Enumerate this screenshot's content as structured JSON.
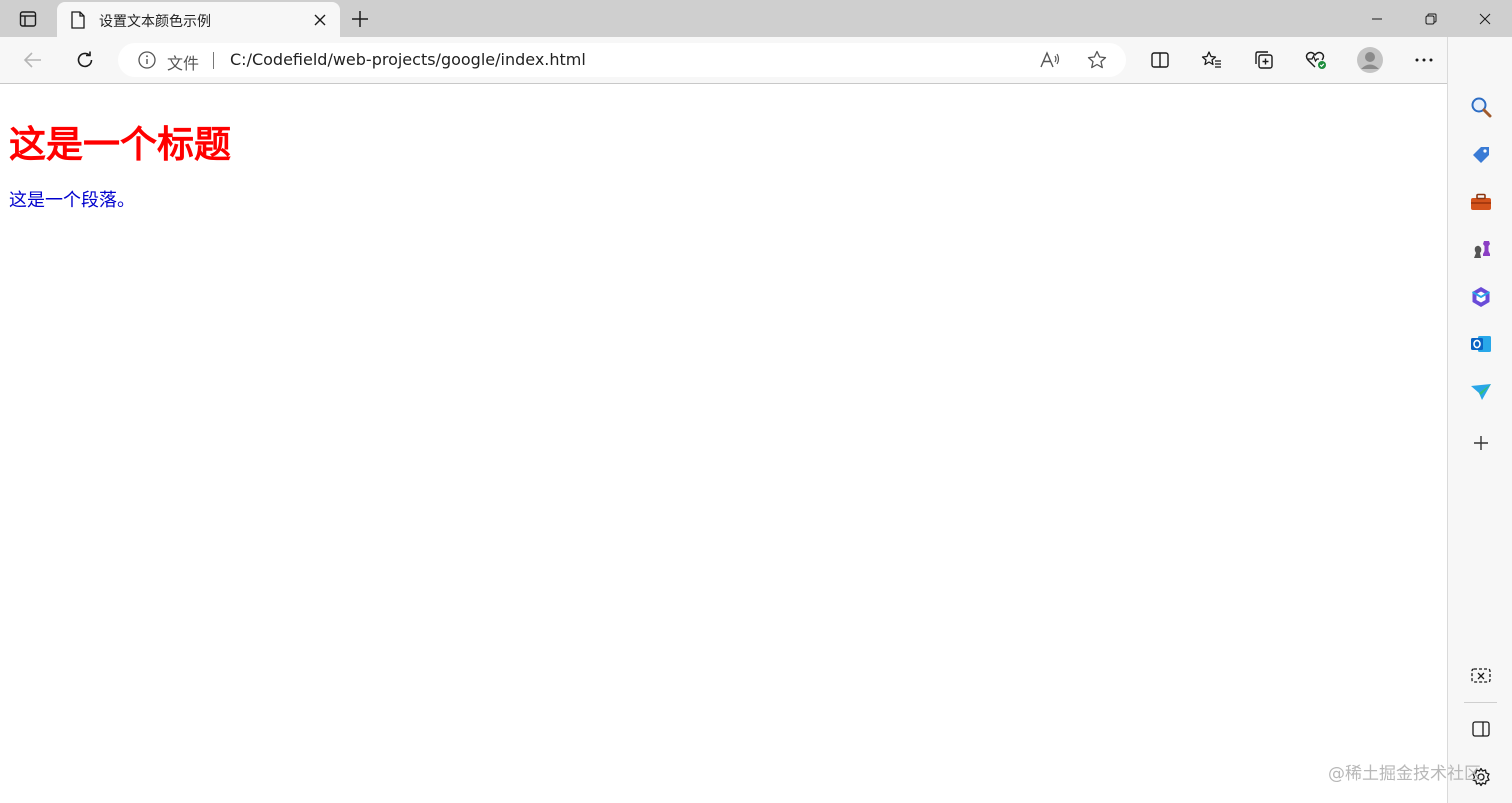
{
  "tab": {
    "title": "设置文本颜色示例"
  },
  "addressbar": {
    "scheme_label": "文件",
    "url": "C:/Codefield/web-projects/google/index.html"
  },
  "page": {
    "heading": "这是一个标题",
    "paragraph": "这是一个段落。"
  },
  "watermark": "@稀土掘金技术社区",
  "colors": {
    "heading": "#ff0000",
    "paragraph": "#0000cd",
    "tabstrip": "#cfcfcf",
    "toolbar": "#f7f7f7"
  },
  "icons": {
    "tab_actions": "tab-actions-icon",
    "back": "back-arrow-icon",
    "refresh": "refresh-icon",
    "info": "info-icon",
    "read_aloud": "read-aloud-icon",
    "favorite": "star-icon",
    "split_screen": "split-screen-icon",
    "favorites": "favorites-icon",
    "collections": "collections-icon",
    "browser_essentials": "heart-pulse-icon",
    "profile": "avatar-icon",
    "more": "more-icon",
    "copilot": "bing-icon",
    "sidebar": [
      "search-icon",
      "shopping-tag-icon",
      "tools-icon",
      "games-icon",
      "office-icon",
      "outlook-icon",
      "drop-icon",
      "add-icon",
      "screenshot-icon",
      "hide-sidebar-icon",
      "settings-icon"
    ]
  }
}
